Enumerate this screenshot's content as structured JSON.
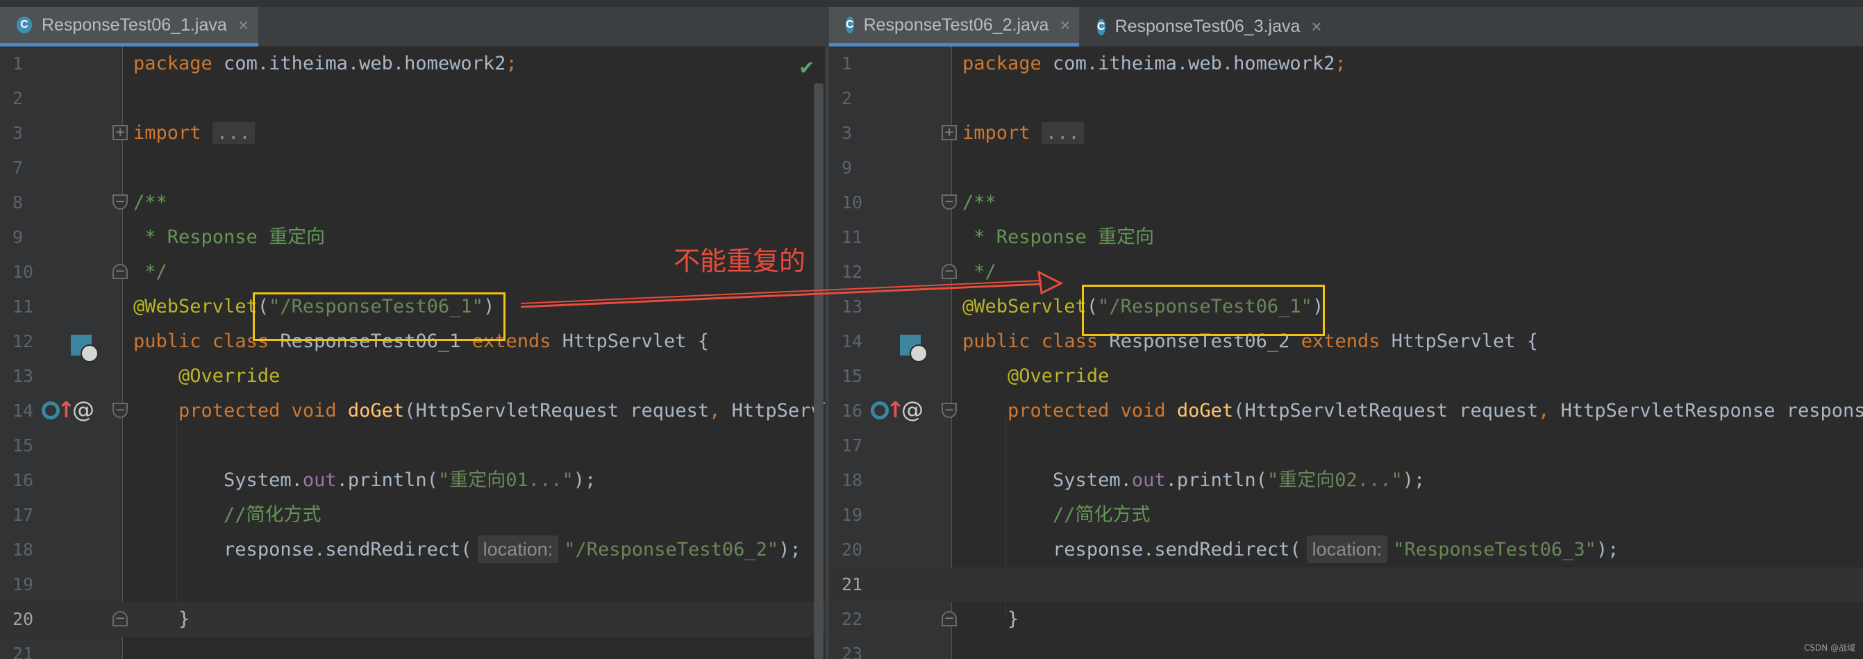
{
  "annotation": {
    "text": "不能重复的",
    "color": "#e74c3c"
  },
  "watermark": "CSDN @战域",
  "left": {
    "tabs": [
      {
        "label": "ResponseTest06_1.java",
        "active": true
      }
    ],
    "line_numbers": [
      "1",
      "2",
      "3",
      "7",
      "8",
      "9",
      "10",
      "11",
      "12",
      "13",
      "14",
      "15",
      "16",
      "17",
      "18",
      "19",
      "20",
      "21"
    ],
    "current_line": "20",
    "code": {
      "pkg_kw": "package",
      "pkg_name": " com.itheima.web.homework2",
      "semicolon": ";",
      "import_kw": "import",
      "folded": "...",
      "doc_open": "/**",
      "doc_line": " * Response 重定向",
      "doc_close": " */",
      "anno": "@WebServlet",
      "paren_open": "(",
      "anno_value": "\"/ResponseTest06_1\"",
      "paren_close": ")",
      "cls_public": "public",
      "cls_class": "class",
      "cls_name": " ResponseTest06_1 ",
      "cls_extends": "extends",
      "cls_super": " HttpServlet {",
      "override": "@Override",
      "m_protected": "protected",
      "m_void": "void",
      "m_name": "doGet",
      "m_params": "(HttpServletRequest request",
      "m_comma": ",",
      "m_params2": " HttpServletResponse response)",
      "sys": "System.",
      "out": "out",
      "println": ".println(",
      "print_str": "\"重定向01...\"",
      "stmt_end": ");",
      "comment": "//简化方式",
      "redirect": "response.sendRedirect(",
      "hint": "location:",
      "redirect_str": "\"/ResponseTest06_2\"",
      "close_brace": "}"
    }
  },
  "right": {
    "tabs": [
      {
        "label": "ResponseTest06_2.java",
        "active": true
      },
      {
        "label": "ResponseTest06_3.java",
        "active": false
      }
    ],
    "line_numbers": [
      "1",
      "2",
      "3",
      "9",
      "10",
      "11",
      "12",
      "13",
      "14",
      "15",
      "16",
      "17",
      "18",
      "19",
      "20",
      "21",
      "22",
      "23"
    ],
    "current_line": "21",
    "code": {
      "pkg_kw": "package",
      "pkg_name": " com.itheima.web.homework2",
      "semicolon": ";",
      "import_kw": "import",
      "folded": "...",
      "doc_open": "/**",
      "doc_line": " * Response 重定向",
      "doc_close": " */",
      "anno": "@WebServlet",
      "paren_open": "(",
      "anno_value": "\"/ResponseTest06_1\"",
      "paren_close": ")",
      "cls_public": "public",
      "cls_class": "class",
      "cls_name": " ResponseTest06_2 ",
      "cls_extends": "extends",
      "cls_super": " HttpServlet {",
      "override": "@Override",
      "m_protected": "protected",
      "m_void": "void",
      "m_name": "doGet",
      "m_params": "(HttpServletRequest request",
      "m_comma": ",",
      "m_params2": " HttpServletResponse response)",
      "sys": "System.",
      "out": "out",
      "println": ".println(",
      "print_str": "\"重定向02...\"",
      "stmt_end": ");",
      "comment": "//简化方式",
      "redirect": "response.sendRedirect(",
      "hint": "location:",
      "redirect_str": "\"ResponseTest06_3\"",
      "close_brace": "}"
    }
  }
}
